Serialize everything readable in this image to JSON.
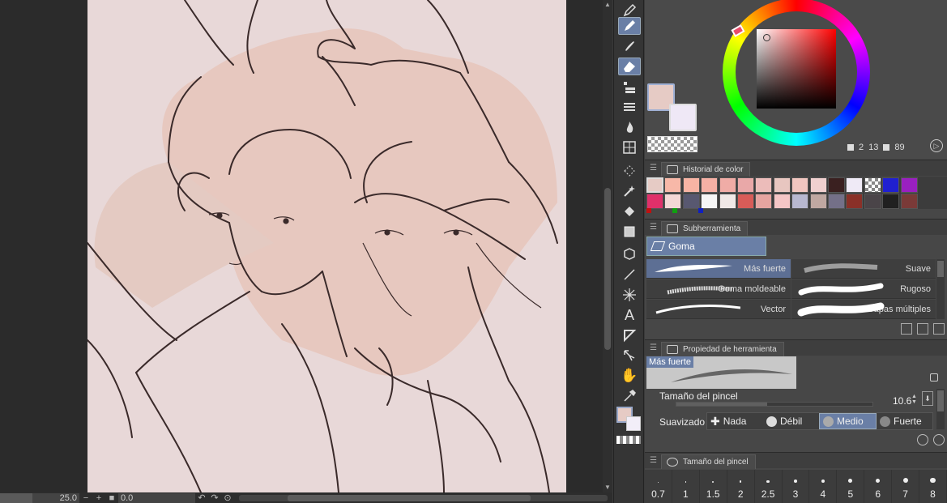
{
  "statusbar": {
    "zoom": "25.0",
    "zoom_out": "−",
    "zoom_in": "+",
    "fit": "■",
    "angle": "0.0"
  },
  "color_panel": {
    "main_color": "#e6cbc5",
    "sub_color": "#efe8f6",
    "h": "2",
    "s": "13",
    "v": "89"
  },
  "history": {
    "tab_label": "Historial de color",
    "row1": [
      "#e6cbc5",
      "#f7b8a8",
      "#f8b4a4",
      "#f5b0a5",
      "#f0aca6",
      "#e9a8a8",
      "#ecbcba",
      "#e8c6c0",
      "#f1c6c0",
      "#f0d0cf",
      "#3a2020",
      "#efeaf6",
      "checker",
      "#2020d0",
      "#9a20c0"
    ],
    "row2": [
      "#e0306a",
      "#f4d8d6",
      "#585870",
      "#f6f6f6",
      "#f0e8e6",
      "#d85c58",
      "#e6a4a0",
      "#f5c6c6",
      "#b8b8d0",
      "#c0a8a2",
      "#747088",
      "#8a3028",
      "#4a4448",
      "#202020",
      "#7a3a38"
    ]
  },
  "subtool": {
    "tab_label": "Subherramienta",
    "group_label": "Goma",
    "brushes": [
      {
        "label": "Más fuerte"
      },
      {
        "label": "Suave"
      },
      {
        "label": "Goma moldeable"
      },
      {
        "label": "Rugoso"
      },
      {
        "label": "Vector"
      },
      {
        "label": "Capas múltiples"
      }
    ]
  },
  "tool_property": {
    "tab_label": "Propiedad de herramienta",
    "preview_label": "Más fuerte",
    "brush_size_label": "Tamaño del pincel",
    "brush_size_value": "10.6",
    "brush_size_fraction": 0.46,
    "smoothing_label": "Suavizado",
    "smoothing_options": [
      "Nada",
      "Débil",
      "Medio",
      "Fuerte"
    ],
    "smoothing_selected": "Medio"
  },
  "brush_size": {
    "tab_label": "Tamaño del pincel",
    "presets": [
      "0.7",
      "1",
      "1.5",
      "2",
      "2.5",
      "3",
      "4",
      "5",
      "6",
      "7",
      "8"
    ]
  },
  "toolbar": {
    "tools": [
      "pen-icon",
      "pencil-icon",
      "brush-icon",
      "eraser-icon",
      "decoration-icon",
      "blend-icon",
      "fill-icon",
      "gradient-icon",
      "figure-icon",
      "move-icon",
      "selection-icon",
      "auto-select-icon",
      "bucket-icon",
      "layer-icon",
      "object-icon",
      "line-icon",
      "burst-icon",
      "text-icon",
      "balloon-icon",
      "correction-icon",
      "hand-icon",
      "eyedropper-icon"
    ],
    "active_tool": "eraser-icon"
  }
}
